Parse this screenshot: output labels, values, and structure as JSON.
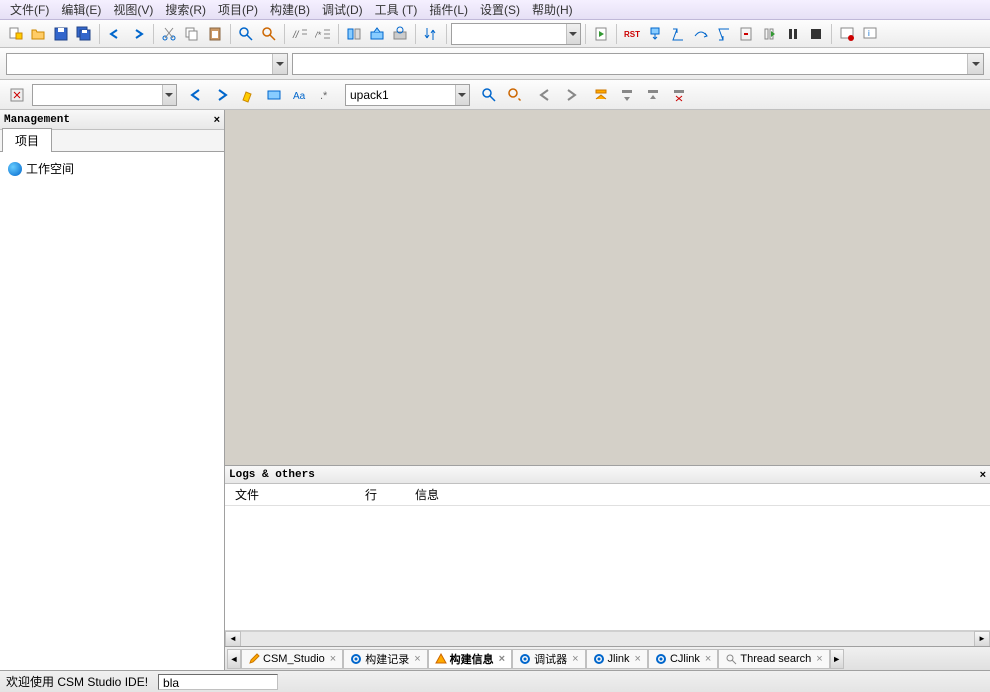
{
  "menu": [
    "文件(F)",
    "编辑(E)",
    "视图(V)",
    "搜索(R)",
    "项目(P)",
    "构建(B)",
    "调试(D)",
    "工具 (T)",
    "插件(L)",
    "设置(S)",
    "帮助(H)"
  ],
  "search_combo": "upack1",
  "management": {
    "title": "Management",
    "tab": "项目",
    "root": "工作空间"
  },
  "logs": {
    "title": "Logs & others",
    "cols": [
      "文件",
      "行",
      "信息"
    ]
  },
  "bottom_tabs": [
    {
      "label": "CSM_Studio",
      "icon": "pencil"
    },
    {
      "label": "构建记录",
      "icon": "gear"
    },
    {
      "label": "构建信息",
      "icon": "warn",
      "active": true
    },
    {
      "label": "调试器",
      "icon": "gear"
    },
    {
      "label": "Jlink",
      "icon": "gear"
    },
    {
      "label": "CJlink",
      "icon": "gear"
    },
    {
      "label": "Thread search",
      "icon": "search"
    }
  ],
  "status": {
    "welcome": "欢迎使用 CSM Studio IDE!",
    "field": "bla"
  }
}
